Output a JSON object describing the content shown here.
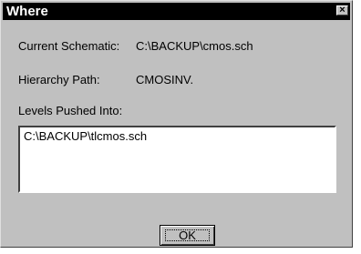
{
  "window": {
    "title": "Where",
    "close_glyph": "×"
  },
  "fields": {
    "current_schematic_label": "Current Schematic:",
    "current_schematic_value": "C:\\BACKUP\\cmos.sch",
    "hierarchy_path_label": "Hierarchy Path:",
    "hierarchy_path_value": "CMOSINV.",
    "levels_label": "Levels Pushed Into:"
  },
  "levels_list": {
    "items": [
      "C:\\BACKUP\\tlcmos.sch"
    ]
  },
  "buttons": {
    "ok_label": "OK"
  },
  "colors": {
    "dialog_background": "#c0c0c0",
    "titlebar_background": "#000000",
    "titlebar_text": "#ffffff",
    "list_background": "#ffffff"
  }
}
